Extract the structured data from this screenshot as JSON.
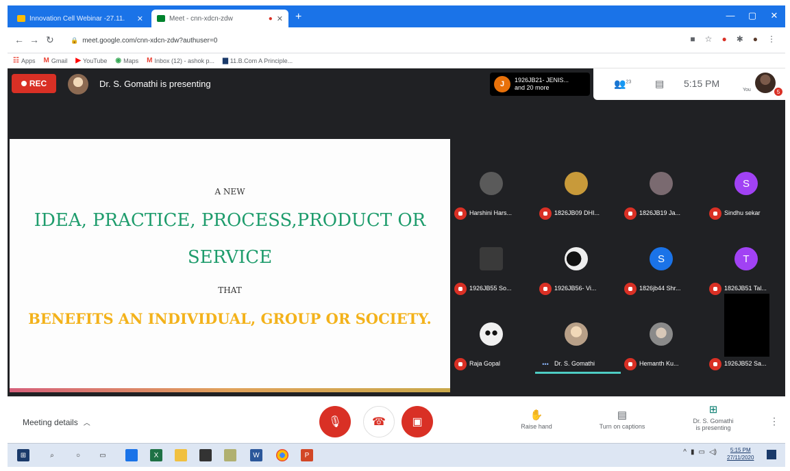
{
  "browser": {
    "tabs": [
      {
        "title": "Innovation Cell Webinar -27.11.",
        "active": false
      },
      {
        "title": "Meet - cnn-xdcn-zdw",
        "active": true
      }
    ],
    "url": "meet.google.com/cnn-xdcn-zdw?authuser=0",
    "bookmarks": [
      "Apps",
      "Gmail",
      "YouTube",
      "Maps",
      "Inbox (12) - ashok p...",
      "11.B.Com A Principle..."
    ]
  },
  "meet": {
    "rec_label": "REC",
    "presenting_text": "Dr. S. Gomathi is presenting",
    "participants_chip": {
      "initial": "J",
      "line1": "1926JB21- JENIS...",
      "line2": "and 20 more"
    },
    "participant_count": "23",
    "clock": "5:15 PM",
    "you_label": "You",
    "you_badge": "5"
  },
  "slide": {
    "line1": "A NEW",
    "line2": "IDEA, PRACTICE, PROCESS,PRODUCT OR",
    "line3": "SERVICE",
    "line4": "THAT",
    "line5": "BENEFITS AN INDIVIDUAL, GROUP OR SOCIETY."
  },
  "participants": [
    {
      "name": "Harshini Hars...",
      "initial": "",
      "color": "#5a5a5a"
    },
    {
      "name": "1826JB09 DHI...",
      "initial": "",
      "color": "#c89a3a"
    },
    {
      "name": "1826JB19 Ja...",
      "initial": "",
      "color": "#7a6a70"
    },
    {
      "name": "Sindhu sekar",
      "initial": "S",
      "color": "#a142f4"
    },
    {
      "name": "1926JB55 So...",
      "initial": "",
      "color": "#3a3a3a"
    },
    {
      "name": "1926JB56- Vi...",
      "initial": "",
      "color": "#e8e8e8"
    },
    {
      "name": "1826jb44 Shr...",
      "initial": "S",
      "color": "#1a73e8"
    },
    {
      "name": "1826JB51 Tal...",
      "initial": "T",
      "color": "#a142f4"
    },
    {
      "name": "Raja Gopal",
      "initial": "",
      "color": "#f0f0f0"
    },
    {
      "name": "Dr. S. Gomathi",
      "initial": "",
      "color": "#b8a088"
    },
    {
      "name": "Hemanth Ku...",
      "initial": "",
      "color": "#8a8a8a"
    },
    {
      "name": "1926JB52 Sa...",
      "initial": "",
      "color": "#000000"
    }
  ],
  "bottom": {
    "meeting_details": "Meeting details",
    "raise_hand": "Raise hand",
    "captions": "Turn on captions",
    "presenting_line1": "Dr. S. Gomathi",
    "presenting_line2": "is presenting"
  },
  "taskbar": {
    "time": "5:15 PM",
    "date": "27/11/2020"
  }
}
